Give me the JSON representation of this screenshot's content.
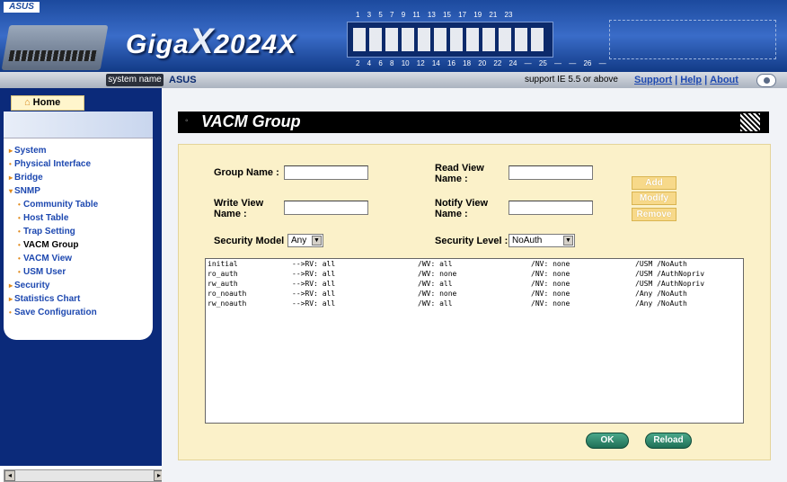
{
  "header": {
    "brand": "ASUS",
    "product_prefix": "Giga",
    "product_x": "X",
    "product_suffix": "2024X",
    "ports_top": "1 3 5 7 9 11 13 15 17 19 21 23",
    "ports_bottom": "2 4 6 8 10 12 14 16 18 20 22 24 — 25 — — 26 —"
  },
  "statusbar": {
    "system_name_label": "system name",
    "system_name_value": "ASUS",
    "support_text": "support IE 5.5 or above",
    "links": [
      "Support",
      "Help",
      "About"
    ]
  },
  "sidebar": {
    "home_label": "Home",
    "items": [
      {
        "label": "System",
        "level": 0
      },
      {
        "label": "Physical Interface",
        "level": 0
      },
      {
        "label": "Bridge",
        "level": 0
      },
      {
        "label": "SNMP",
        "level": 0
      },
      {
        "label": "Community Table",
        "level": 1
      },
      {
        "label": "Host Table",
        "level": 1
      },
      {
        "label": "Trap Setting",
        "level": 1
      },
      {
        "label": "VACM Group",
        "level": 1
      },
      {
        "label": "VACM View",
        "level": 1
      },
      {
        "label": "USM User",
        "level": 1
      },
      {
        "label": "Security",
        "level": 0
      },
      {
        "label": "Statistics Chart",
        "level": 0
      },
      {
        "label": "Save Configuration",
        "level": 0
      }
    ]
  },
  "page": {
    "title": "VACM Group"
  },
  "form": {
    "group_name_label": "Group Name :",
    "group_name_value": "",
    "read_view_label": "Read View Name :",
    "read_view_value": "",
    "write_view_label": "Write View Name :",
    "write_view_value": "",
    "notify_view_label": "Notify View Name :",
    "notify_view_value": "",
    "security_model_label": "Security Model :",
    "security_model_value": "Any",
    "security_level_label": "Security Level :",
    "security_level_value": "NoAuth",
    "add_label": "Add",
    "modify_label": "Modify",
    "remove_label": "Remove"
  },
  "table": {
    "rows": [
      [
        "initial",
        "-->RV: all",
        "/WV: all",
        "/NV: none",
        "/USM /NoAuth"
      ],
      [
        "ro_auth",
        "-->RV: all",
        "/WV: none",
        "/NV: none",
        "/USM /AuthNopriv"
      ],
      [
        "rw_auth",
        "-->RV: all",
        "/WV: all",
        "/NV: none",
        "/USM /AuthNopriv"
      ],
      [
        "ro_noauth",
        "-->RV: all",
        "/WV: none",
        "/NV: none",
        "/Any /NoAuth"
      ],
      [
        "rw_noauth",
        "-->RV: all",
        "/WV: all",
        "/NV: none",
        "/Any /NoAuth"
      ]
    ]
  },
  "footer_buttons": {
    "ok_label": "OK",
    "reload_label": "Reload"
  },
  "colors": {
    "header_blue": "#1c4a9e",
    "sidebar_blue": "#0b2a7a",
    "form_bg": "#fbf1c9",
    "action_button": "#f7d98a",
    "ok_button": "#1f6f56",
    "link_blue": "#1d48b0"
  }
}
